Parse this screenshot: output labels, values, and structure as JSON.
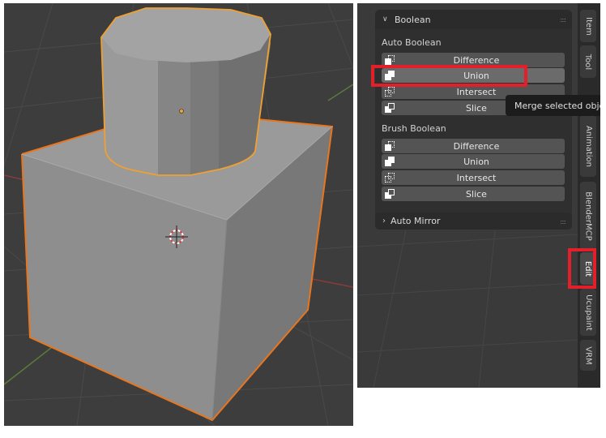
{
  "viewport": {
    "label": "3D Viewport"
  },
  "panel": {
    "boolean_header": "Boolean",
    "auto_boolean_label": "Auto Boolean",
    "auto_buttons": [
      {
        "label": "Difference",
        "icon": "difference-icon"
      },
      {
        "label": "Union",
        "icon": "union-icon",
        "highlighted": true
      },
      {
        "label": "Intersect",
        "icon": "intersect-icon"
      },
      {
        "label": "Slice",
        "icon": "slice-icon"
      }
    ],
    "brush_boolean_label": "Brush Boolean",
    "brush_buttons": [
      {
        "label": "Difference",
        "icon": "difference-icon"
      },
      {
        "label": "Union",
        "icon": "union-icon"
      },
      {
        "label": "Intersect",
        "icon": "intersect-icon"
      },
      {
        "label": "Slice",
        "icon": "slice-icon"
      }
    ],
    "auto_mirror_header": "Auto Mirror",
    "tooltip": "Merge selected obje"
  },
  "tabs": [
    {
      "label": "Item"
    },
    {
      "label": "Tool"
    },
    {
      "label": "Animation"
    },
    {
      "label": "BlenderMCP"
    },
    {
      "label": "Edit",
      "active": true
    },
    {
      "label": "Ucupaint"
    },
    {
      "label": "VRM"
    }
  ],
  "colors": {
    "selection_outline": "#e8761e",
    "annotation": "#e3202a"
  }
}
